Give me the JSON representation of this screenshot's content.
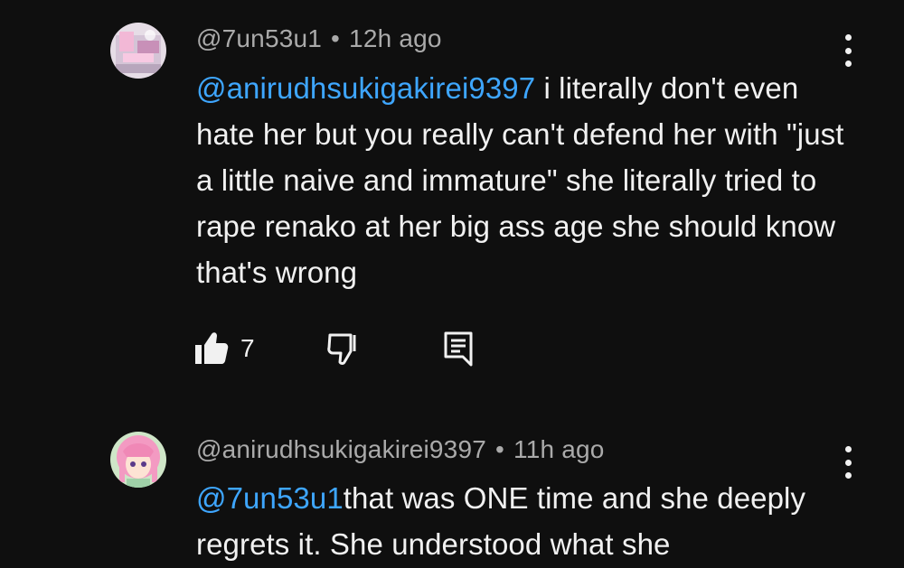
{
  "comments": [
    {
      "author": "@7un53u1",
      "separator": "•",
      "time": "12h ago",
      "mention": "@anirudhsukigakirei9397",
      "text": " i literally don't even hate her but you really can't defend her with \"just a little naive and immature\" she literally tried to rape renako at her big ass age she should know that's wrong",
      "likes": "7",
      "avatar_icon": "pink-anime-avatar"
    },
    {
      "author": "@anirudhsukigakirei9397",
      "separator": "•",
      "time": "11h ago",
      "mention": "@7un53u1",
      "text": "that was ONE time and she deeply regrets it. She understood what she",
      "avatar_icon": "pink-hair-anime-girl-avatar"
    }
  ],
  "icons": {
    "like": "thumbs-up-icon",
    "dislike": "thumbs-down-icon",
    "reply": "reply-comment-icon",
    "menu": "more-vertical-icon"
  },
  "colors": {
    "background": "#0f0f0f",
    "text": "#f1f1f1",
    "meta": "#aaaaaa",
    "mention": "#3ea6ff"
  }
}
